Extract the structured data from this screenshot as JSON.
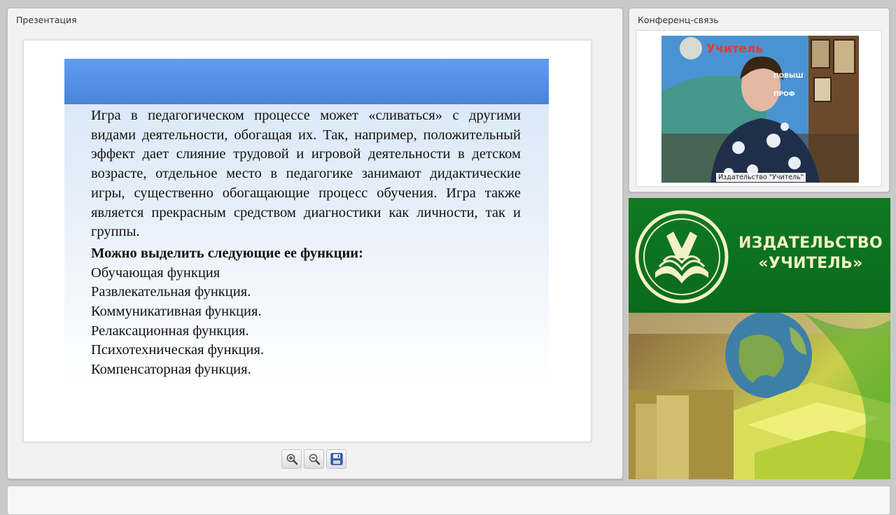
{
  "presentation": {
    "title": "Презентация",
    "slide": {
      "paragraph": "Игра в педагогическом процессе может «сливаться» с другими видами деятельности, обогащая их. Так, например, положительный эффект дает слияние трудовой и игровой деятельности в детском возрасте, отдельное место в педагогике занимают дидактические игры, существенно обогащающие процесс обучения. Игра также является прекрасным средством диагностики как личности, так и группы.",
      "heading": "Можно выделить следующие ее функции:",
      "functions": [
        "Обучающая функция",
        "Развлекательная функция.",
        "Коммуникативная функция.",
        "Релаксационная функция.",
        "Психотехническая функция.",
        "Компенсаторная функция."
      ]
    },
    "toolbar": {
      "zoom_in_icon": "zoom-in-icon",
      "zoom_out_icon": "zoom-out-icon",
      "save_icon": "floppy-disk-icon"
    }
  },
  "conference": {
    "title": "Конференц-связь",
    "video_label": "Издательство \"Учитель\"",
    "backdrop": {
      "logo_word": "Учитель",
      "line_1": "ПОВЫШ",
      "line_2": "ПРОФ"
    }
  },
  "publisher": {
    "name_line_1": "ИЗДАТЕЛЬСТВО",
    "name_line_2": "«УЧИТЕЛЬ»",
    "colors": {
      "green": "#0e7a22",
      "cream": "#f3f0c8"
    }
  }
}
